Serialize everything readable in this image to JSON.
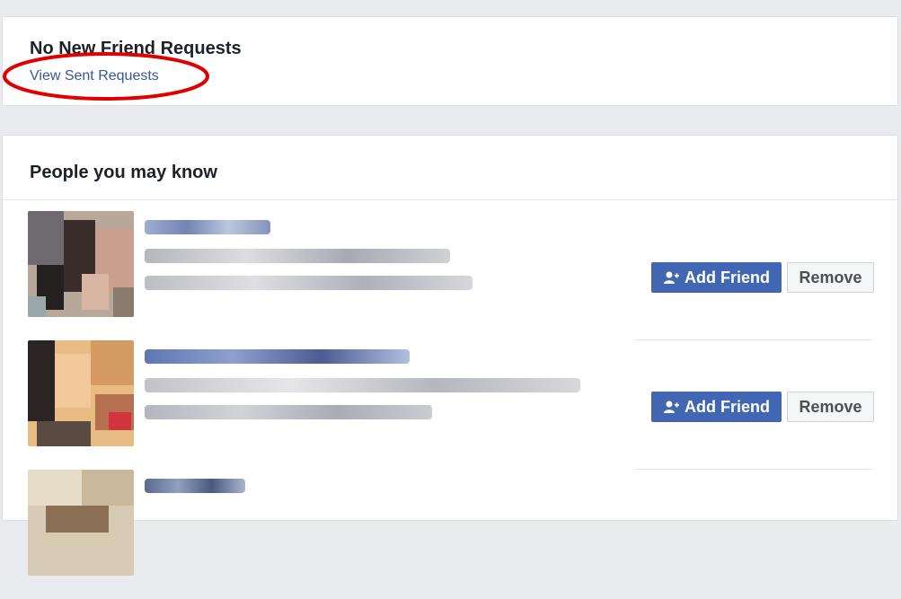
{
  "requests": {
    "title": "No New Friend Requests",
    "sent_link": "View Sent Requests",
    "highlight_color": "#e00000"
  },
  "pymk": {
    "title": "People you may know",
    "suggestions": [
      {
        "add_label": "Add Friend",
        "remove_label": "Remove"
      },
      {
        "add_label": "Add Friend",
        "remove_label": "Remove"
      },
      {
        "add_label": "",
        "remove_label": ""
      }
    ]
  },
  "colors": {
    "page_bg": "#e9ebee",
    "link": "#365899",
    "primary_button": "#4267b2"
  }
}
